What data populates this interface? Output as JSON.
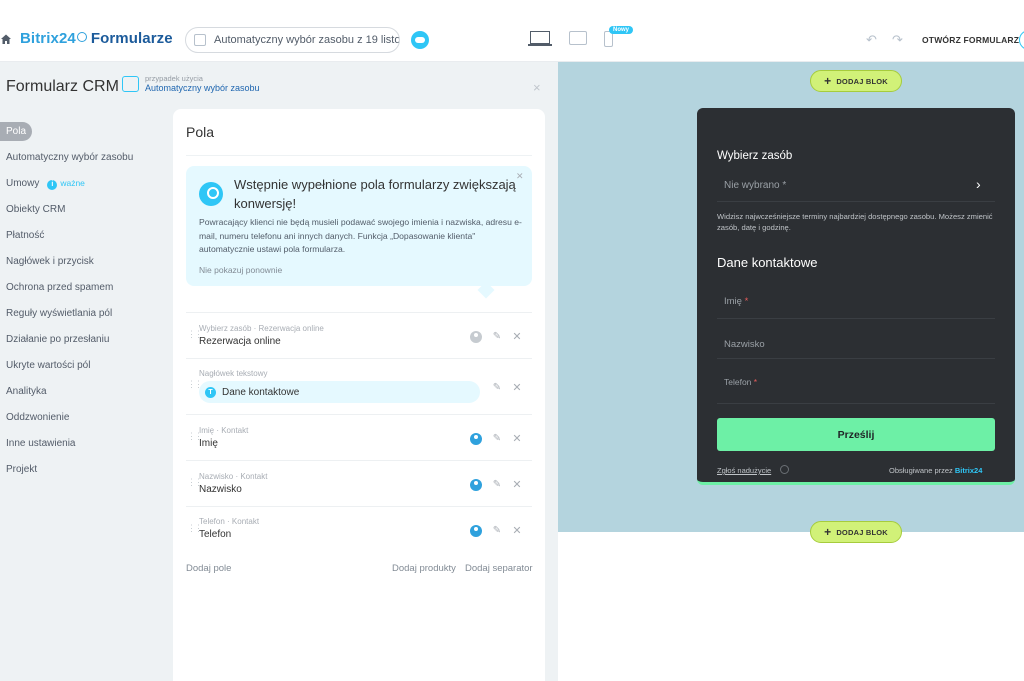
{
  "topbar": {
    "logo_brand": "Bitrix24",
    "logo_product": "Formularze",
    "scenario_value": "Automatyczny wybór zasobu z 19 listo...",
    "new_badge": "Nowy",
    "open_form_label": "OTWÓRZ FORMULARZ"
  },
  "panel": {
    "title": "Formularz CRM",
    "usecase_caption": "przypadek użycia",
    "usecase_value": "Automatyczny wybór zasobu",
    "close": "×"
  },
  "nav": {
    "items": [
      "Pola",
      "Automatyczny wybór zasobu",
      "Umowy",
      "Obiekty CRM",
      "Płatność",
      "Nagłówek i przycisk",
      "Ochrona przed spamem",
      "Reguły wyświetlania pól",
      "Działanie po przesłaniu",
      "Ukryte wartości pól",
      "Analityka",
      "Oddzwonienie",
      "Inne ustawienia",
      "Projekt"
    ],
    "important_label": "ważne"
  },
  "fields_card": {
    "title": "Pola",
    "hint": {
      "title": "Wstępnie wypełnione pola formularzy zwiększają konwersję!",
      "text": "Powracający klienci nie będą musieli podawać swojego imienia i nazwiska, adresu e-mail, numeru telefonu ani innych danych. Funkcja „Dopasowanie klienta\" automatycznie ustawi pola formularza.",
      "dismiss": "Nie pokazuj ponownie"
    },
    "rows": [
      {
        "caption": "Wybierz zasób · Rezerwacja online",
        "title": "Rezerwacja online"
      },
      {
        "caption": "Nagłówek tekstowy",
        "title": "Dane kontaktowe"
      },
      {
        "caption": "Imię · Kontakt",
        "title": "Imię"
      },
      {
        "caption": "Nazwisko · Kontakt",
        "title": "Nazwisko"
      },
      {
        "caption": "Telefon · Kontakt",
        "title": "Telefon"
      }
    ],
    "add_field": "Dodaj pole",
    "add_products": "Dodaj produkty",
    "add_separator": "Dodaj separator"
  },
  "preview": {
    "add_block_label": "DODAJ BLOK",
    "form": {
      "resource_heading": "Wybierz zasób",
      "resource_placeholder": "Nie wybrano *",
      "resource_note": "Widzisz najwcześniejsze terminy najbardziej dostępnego zasobu. Możesz zmienić zasób, datę i godzinę.",
      "contact_heading": "Dane kontaktowe",
      "first_name": "Imię",
      "last_name": "Nazwisko",
      "phone": "Telefon",
      "required_mark": "*",
      "submit": "Prześlij",
      "report_abuse": "Zgłoś nadużycie",
      "powered_by": "Obsługiwane przez",
      "powered_brand": "Bitrix24"
    }
  },
  "colors": {
    "accent": "#2fc6f6",
    "form_bg": "#2c2f33",
    "submit": "#6df0a6",
    "add_block": "#d1f178",
    "preview_bg": "#b4d4de"
  }
}
